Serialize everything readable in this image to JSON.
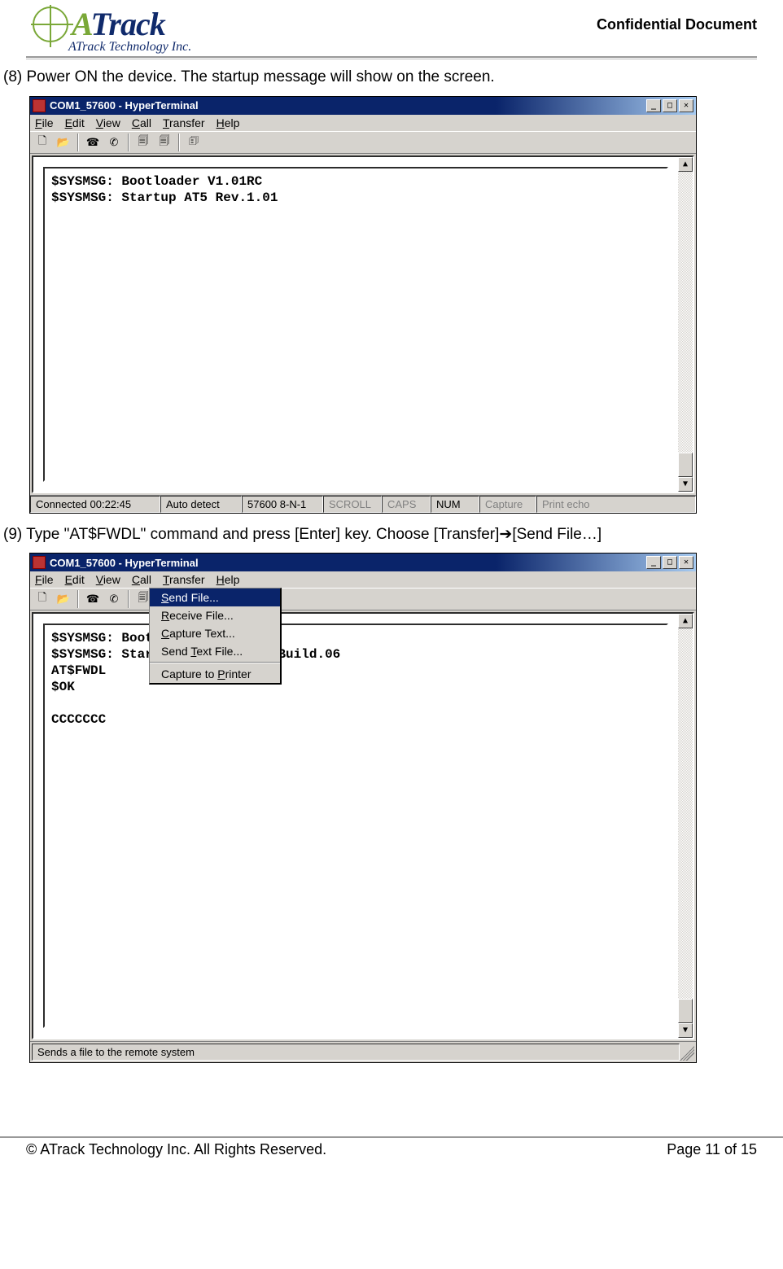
{
  "header": {
    "logo_main_a": "A",
    "logo_main_b": "Track",
    "logo_sub": "ATrack Technology Inc.",
    "confidential": "Confidential  Document"
  },
  "instr8": "(8) Power ON the device. The startup message will show on the screen.",
  "instr9_a": "(9) Type \"AT$FWDL\" command and press [Enter] key. Choose [Transfer]",
  "instr9_arrow": "➔",
  "instr9_b": "[Send File…]",
  "win1": {
    "title": "COM1_57600 - HyperTerminal",
    "menus": {
      "file": "File",
      "edit": "Edit",
      "view": "View",
      "call": "Call",
      "transfer": "Transfer",
      "help": "Help"
    },
    "term_line1": "$SYSMSG: Bootloader V1.01RC",
    "term_line2": "$SYSMSG: Startup AT5 Rev.1.01",
    "status": {
      "connected": "Connected 00:22:45",
      "auto": "Auto detect",
      "baud": "57600 8-N-1",
      "scroll": "SCROLL",
      "caps": "CAPS",
      "num": "NUM",
      "capture": "Capture",
      "echo": "Print echo"
    }
  },
  "win2": {
    "title": "COM1_57600 - HyperTerminal",
    "menus": {
      "file": "File",
      "edit": "Edit",
      "view": "View",
      "call": "Call",
      "transfer": "Transfer",
      "help": "Help"
    },
    "dropdown": {
      "send": "Send File...",
      "receive": "Receive File...",
      "capture": "Capture Text...",
      "sendtext": "Send Text File...",
      "printer": "Capture to Printer"
    },
    "term_line1": "$SYSMSG: Bootl",
    "term_line2a": "$SYSMSG: Start",
    "term_line2b": "Build.06",
    "term_line3": "AT$FWDL",
    "term_line4": "$OK",
    "term_line5": "",
    "term_line6": "CCCCCCC",
    "status": "Sends a file to the remote system"
  },
  "footer": {
    "left": "© ATrack Technology Inc. All Rights Reserved.",
    "right": "Page 11 of 15"
  }
}
